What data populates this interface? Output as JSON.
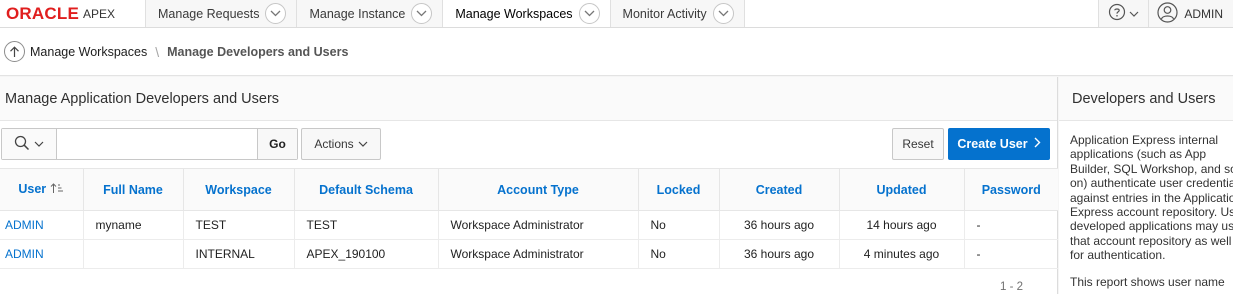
{
  "brand": {
    "oracle": "ORACLE",
    "apex": "APEX"
  },
  "nav": {
    "tabs": [
      {
        "label": "Manage Requests"
      },
      {
        "label": "Manage Instance"
      },
      {
        "label": "Manage Workspaces"
      },
      {
        "label": "Monitor Activity"
      }
    ],
    "active_tab": "Manage Workspaces",
    "user_label": "ADMIN"
  },
  "breadcrumb": {
    "parent": "Manage Workspaces",
    "current": "Manage Developers and Users"
  },
  "main": {
    "region_title": "Manage Application Developers and Users",
    "toolbar": {
      "search_value": "",
      "go_label": "Go",
      "actions_label": "Actions",
      "reset_label": "Reset",
      "create_label": "Create User"
    },
    "columns": [
      "User",
      "Full Name",
      "Workspace",
      "Default Schema",
      "Account Type",
      "Locked",
      "Created",
      "Updated",
      "Password"
    ],
    "rows": [
      [
        "ADMIN",
        "myname",
        "TEST",
        "TEST",
        "Workspace Administrator",
        "No",
        "36 hours ago",
        "14 hours ago",
        "-"
      ],
      [
        "ADMIN",
        "",
        "INTERNAL",
        "APEX_190100",
        "Workspace Administrator",
        "No",
        "36 hours ago",
        "4 minutes ago",
        "-"
      ]
    ],
    "pagination": "1 - 2"
  },
  "side": {
    "title": "Developers and Users",
    "lines": [
      "Application Express internal",
      "applications (such as App",
      "Builder, SQL Workshop, and so",
      "on) authenticate user credentials",
      "against entries in the Application",
      "Express account repository. Users of",
      "developed applications may use",
      "that account repository as well",
      "for authentication."
    ],
    "p2": "This report shows user name"
  },
  "colors": {
    "accent": "#0572ce",
    "brand_red": "#e01e1e"
  },
  "icons": [
    "chevron-down-icon",
    "help-icon",
    "user-icon",
    "up-arrow-icon",
    "search-icon",
    "sort-ascending-icon",
    "chevron-right-icon"
  ]
}
